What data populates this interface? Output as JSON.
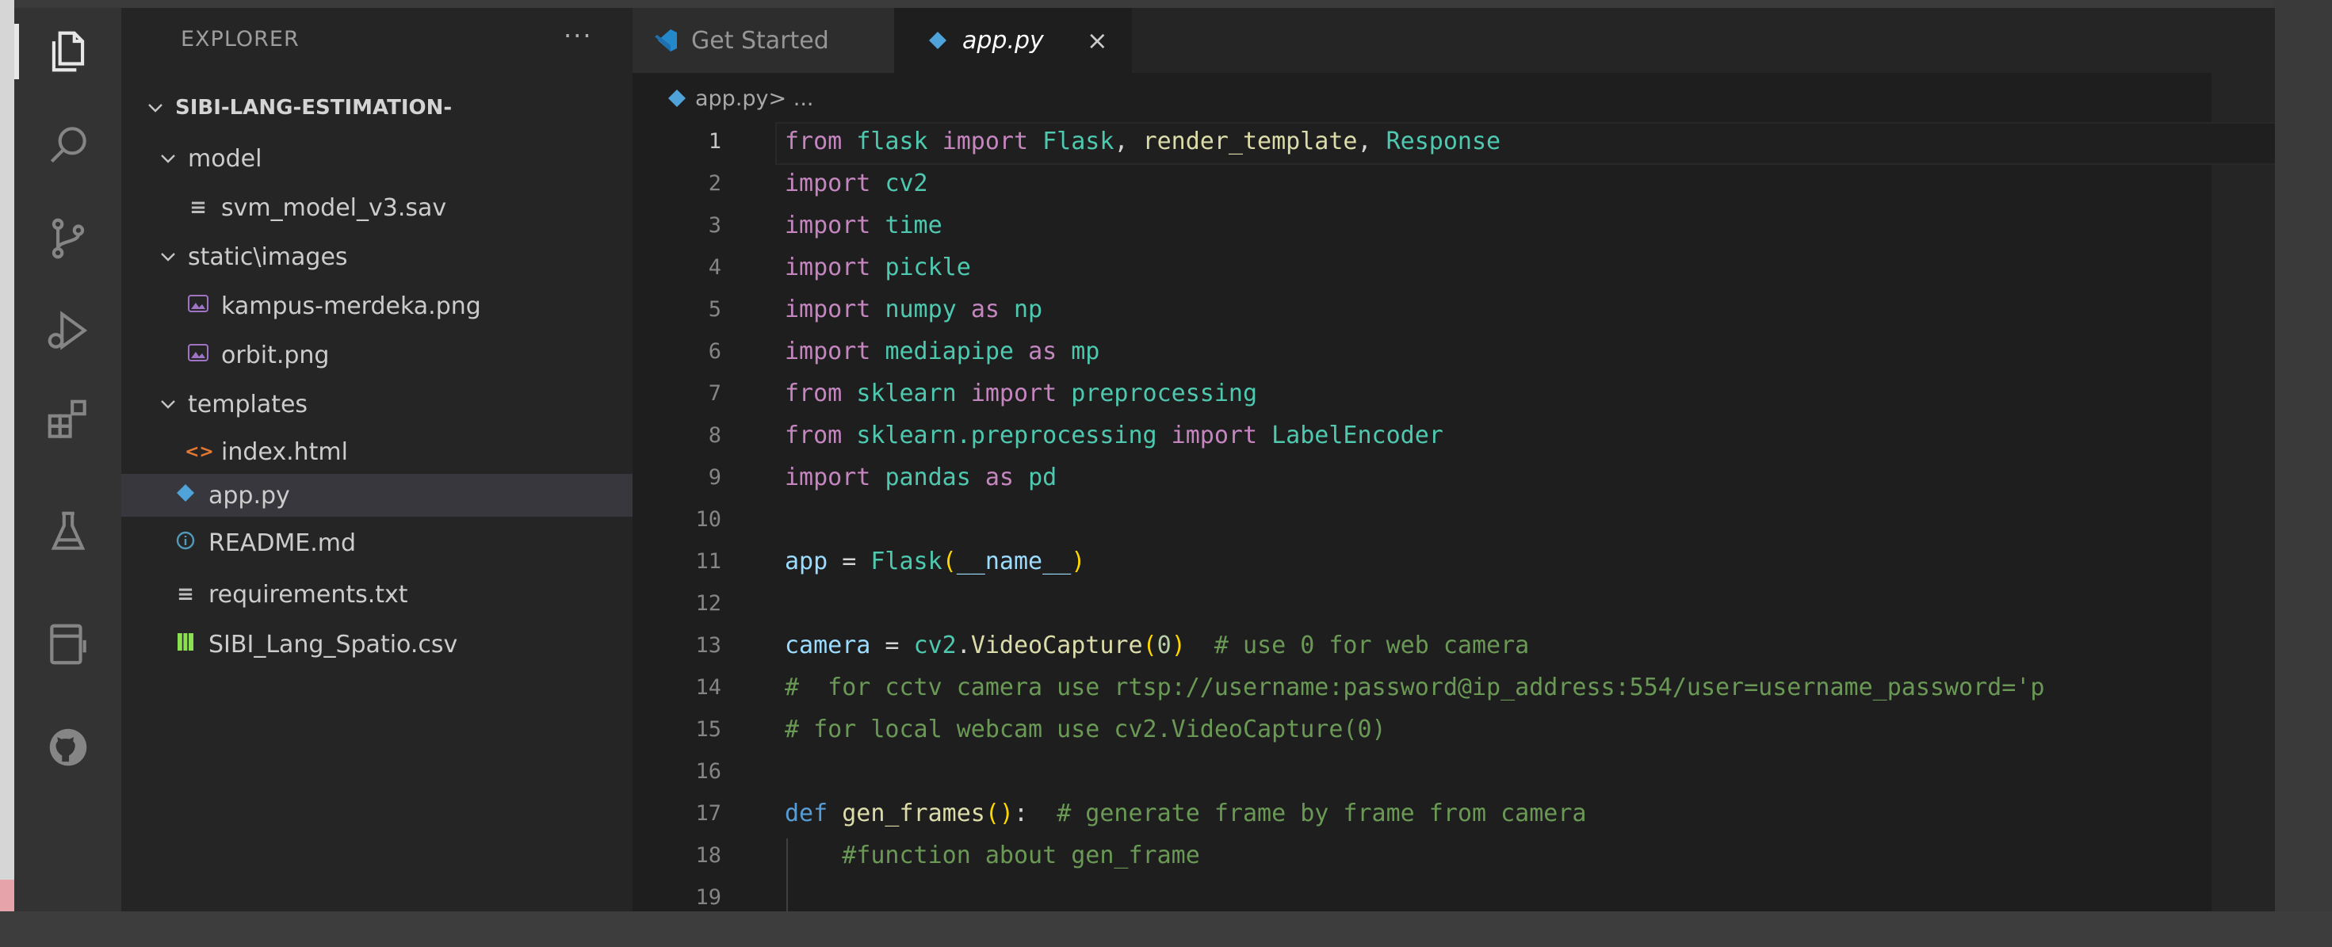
{
  "sidebar": {
    "title": "EXPLORER",
    "more_actions": "···",
    "tree": [
      {
        "label": "SIBI-LANG-ESTIMATION-",
        "icon": "chevron-down-icon"
      },
      {
        "label": "model",
        "icon": "chevron-down-icon"
      },
      {
        "label": "svm_model_v3.sav",
        "icon": "generic-file-icon"
      },
      {
        "label": "static\\images",
        "icon": "chevron-down-icon"
      },
      {
        "label": "kampus-merdeka.png",
        "icon": "image-file-icon"
      },
      {
        "label": "orbit.png",
        "icon": "image-file-icon"
      },
      {
        "label": "templates",
        "icon": "chevron-down-icon"
      },
      {
        "label": "index.html",
        "icon": "html-file-icon"
      },
      {
        "label": "app.py",
        "icon": "python-file-icon"
      },
      {
        "label": "README.md",
        "icon": "info-file-icon"
      },
      {
        "label": "requirements.txt",
        "icon": "generic-file-icon"
      },
      {
        "label": "SIBI_Lang_Spatio.csv",
        "icon": "csv-file-icon"
      }
    ]
  },
  "editor": {
    "tabs": [
      {
        "label": "Get Started",
        "icon": "vscode-logo-icon"
      },
      {
        "label": "app.py",
        "icon": "python-file-icon",
        "close": "×"
      }
    ],
    "breadcrumb": {
      "file": "app.py",
      "rest": " > ..."
    },
    "lines": [
      {
        "n": "1",
        "text": "from flask import Flask, render_template, Response"
      },
      {
        "n": "2",
        "text": "import cv2"
      },
      {
        "n": "3",
        "text": "import time"
      },
      {
        "n": "4",
        "text": "import pickle"
      },
      {
        "n": "5",
        "text": "import numpy as np"
      },
      {
        "n": "6",
        "text": "import mediapipe as mp"
      },
      {
        "n": "7",
        "text": "from sklearn import preprocessing"
      },
      {
        "n": "8",
        "text": "from sklearn.preprocessing import LabelEncoder"
      },
      {
        "n": "9",
        "text": "import pandas as pd"
      },
      {
        "n": "10",
        "text": ""
      },
      {
        "n": "11",
        "text": "app = Flask(__name__)"
      },
      {
        "n": "12",
        "text": ""
      },
      {
        "n": "13",
        "text": "camera = cv2.VideoCapture(0)  # use 0 for web camera"
      },
      {
        "n": "14",
        "text": "#  for cctv camera use rtsp://username:password@ip_address:554/user=username_password='p"
      },
      {
        "n": "15",
        "text": "# for local webcam use cv2.VideoCapture(0)"
      },
      {
        "n": "16",
        "text": ""
      },
      {
        "n": "17",
        "text": "def gen_frames():  # generate frame by frame from camera"
      },
      {
        "n": "18",
        "text": "    #function about gen_frame"
      },
      {
        "n": "19",
        "text": ""
      }
    ]
  },
  "colors": {
    "keyword": "#c586c0",
    "def": "#569cd6",
    "function": "#dcdcaa",
    "class": "#4ec9b0",
    "variable": "#9cdcfe",
    "comment": "#6a9955",
    "number": "#b5cea8",
    "python_icon": "#4fa3d9",
    "image_icon": "#a074c4",
    "html_icon": "#e37933",
    "csv_icon": "#89e051"
  }
}
